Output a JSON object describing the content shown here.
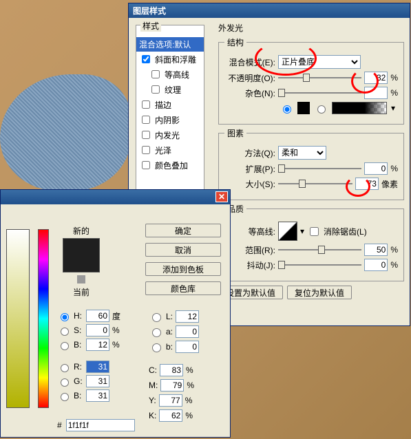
{
  "layerstyle": {
    "title": "图层样式",
    "styles_label": "样式",
    "blend_options": "混合选项:默认",
    "items": [
      {
        "label": "斜面和浮雕",
        "checked": true
      },
      {
        "label": "等高线",
        "checked": false
      },
      {
        "label": "纹理",
        "checked": false
      },
      {
        "label": "描边",
        "checked": false
      },
      {
        "label": "内阴影",
        "checked": false
      },
      {
        "label": "内发光",
        "checked": false
      },
      {
        "label": "光泽",
        "checked": false
      },
      {
        "label": "颜色叠加",
        "checked": false
      }
    ],
    "outerglow": {
      "title": "外发光",
      "structure_title": "结构",
      "blendmode_label": "混合模式(E):",
      "blendmode_value": "正片叠底",
      "opacity_label": "不透明度(O):",
      "opacity_value": "32",
      "pct": "%",
      "noise_label": "杂色(N):",
      "noise_value": "",
      "elements_title": "图素",
      "method_label": "方法(Q):",
      "method_value": "柔和",
      "spread_label": "扩展(P):",
      "spread_value": "0",
      "size_label": "大小(S):",
      "size_value": "73",
      "px": "像素",
      "quality_title": "品质",
      "contour_label": "等高线:",
      "antialias_label": "消除锯齿(L)",
      "range_label": "范围(R):",
      "range_value": "50",
      "jitter_label": "抖动(J):",
      "jitter_value": "0",
      "default_btn": "设置为默认值",
      "reset_btn": "复位为默认值"
    }
  },
  "colorpicker": {
    "new_label": "新的",
    "current_label": "当前",
    "ok": "确定",
    "cancel": "取消",
    "add_swatch": "添加到色板",
    "libraries": "颜色库",
    "hsb": {
      "H": "60",
      "H_unit": "度",
      "S": "0",
      "S_unit": "%",
      "Bv": "12",
      "Bv_unit": "%"
    },
    "lab": {
      "L": "12",
      "a": "0",
      "b": "0"
    },
    "rgb": {
      "R": "31",
      "G": "31",
      "B": "31"
    },
    "cmyk": {
      "C": "83",
      "M": "79",
      "Y": "77",
      "K": "62"
    },
    "pct": "%",
    "hash": "#",
    "hex": "1f1f1f"
  },
  "chart_data": null
}
